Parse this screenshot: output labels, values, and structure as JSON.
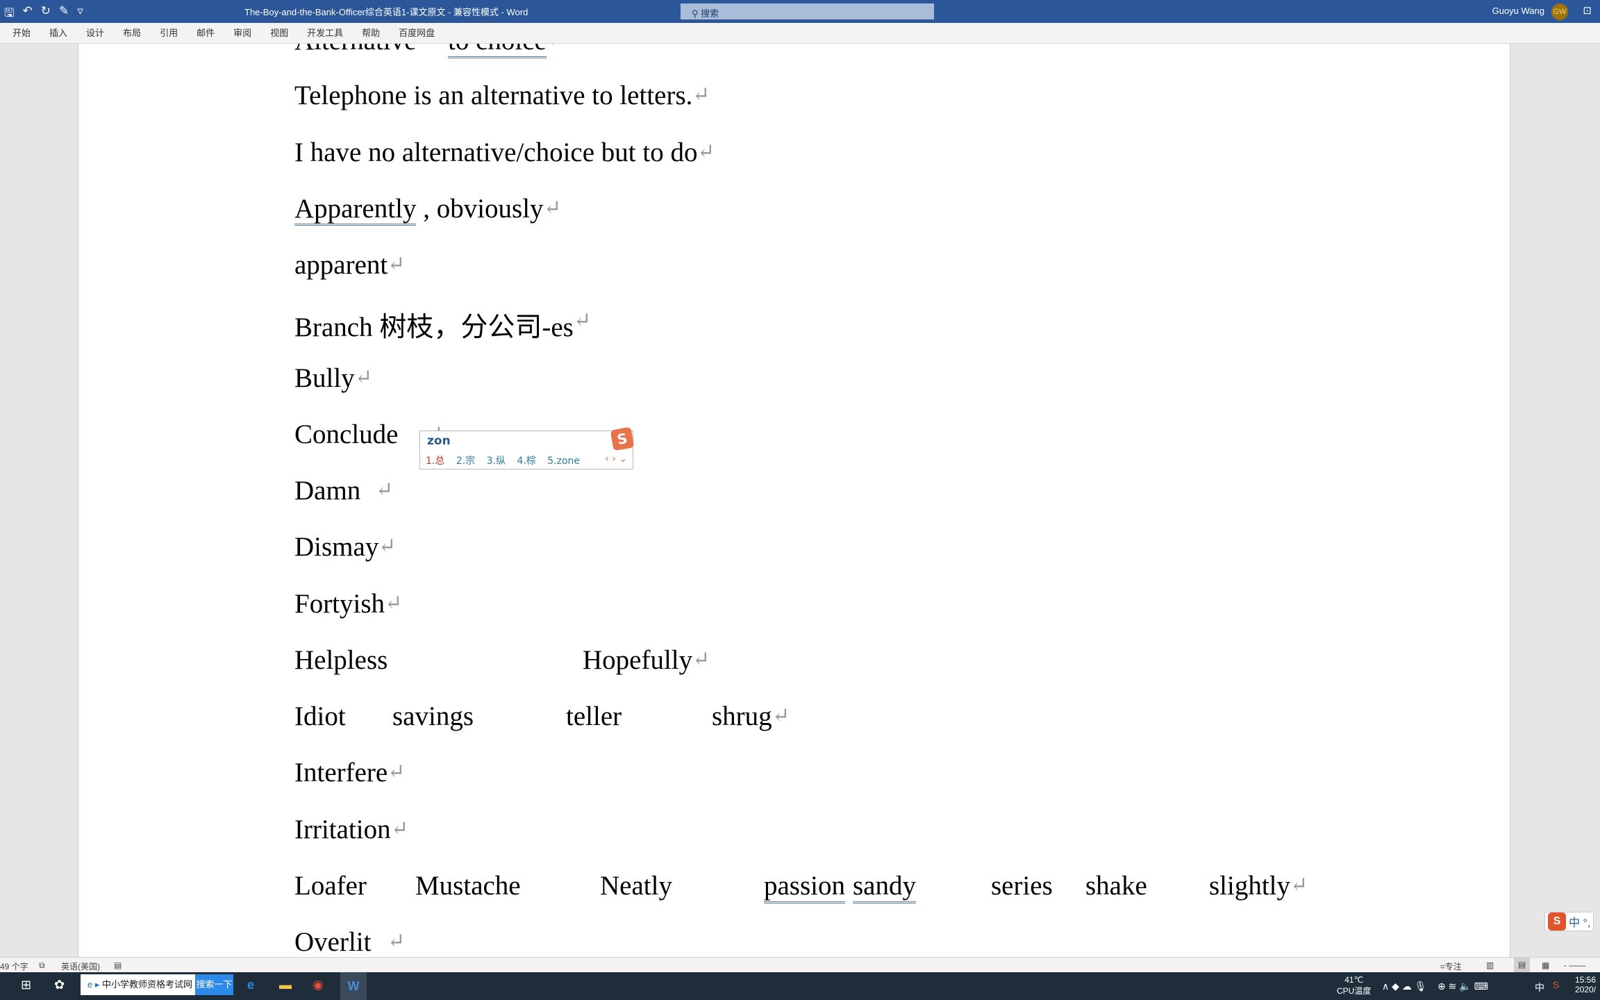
{
  "titlebar": {
    "title": "The-Boy-and-the-Bank-Officer综合英语1-课文原文  -  兼容性模式  -  Word",
    "search_placeholder": "搜索",
    "user_name": "Guoyu Wang",
    "avatar_initials": "GW",
    "accent": "#2b579a"
  },
  "ribbon": {
    "tabs": [
      "开始",
      "插入",
      "设计",
      "布局",
      "引用",
      "邮件",
      "审阅",
      "视图",
      "开发工具",
      "帮助",
      "百度网盘"
    ]
  },
  "document": {
    "lines": [
      {
        "words": [
          "Alternative",
          "to    choice"
        ]
      },
      {
        "words": [
          "Telephone is an alternative to letters."
        ]
      },
      {
        "words": [
          "I have no alternative/choice but to do"
        ]
      },
      {
        "words": [
          "Apparently , obviously"
        ]
      },
      {
        "words": [
          "apparent"
        ]
      },
      {
        "words": [
          "Branch  树枝，分公司-es"
        ]
      },
      {
        "words": [
          "Bully"
        ]
      },
      {
        "words": [
          "Conclude"
        ]
      },
      {
        "words": [
          "Damn"
        ]
      },
      {
        "words": [
          "Dismay"
        ]
      },
      {
        "words": [
          "Fortyish"
        ]
      },
      {
        "words": [
          "Helpless",
          "Hopefully"
        ]
      },
      {
        "words": [
          "Idiot",
          "savings",
          "teller",
          "shrug"
        ]
      },
      {
        "words": [
          "Interfere"
        ]
      },
      {
        "words": [
          "Irritation"
        ]
      },
      {
        "words": [
          "Loafer",
          "Mustache",
          "Neatly",
          "passion",
          "sandy",
          "series",
          "shake",
          "slightly"
        ]
      },
      {
        "words": [
          "Overlit"
        ]
      }
    ],
    "paragraph_mark": "↵"
  },
  "ime": {
    "composition": "zon",
    "candidates": [
      "1.总",
      "2.宗",
      "3.纵",
      "4.棕",
      "5.zone"
    ],
    "logo": "S",
    "nav": "‹ › ⌄",
    "bar_label": "中 °,"
  },
  "statusbar": {
    "word_count": "49 个字",
    "language": "英语(美国)",
    "focus": "专注"
  },
  "taskbar": {
    "search_text": "中小学教师资格考试网",
    "search_button": "搜索一下",
    "temperature": "41℃",
    "temp_label": "CPU温度",
    "ime_indicator": "中",
    "time": "15:56",
    "date": "2020/"
  }
}
